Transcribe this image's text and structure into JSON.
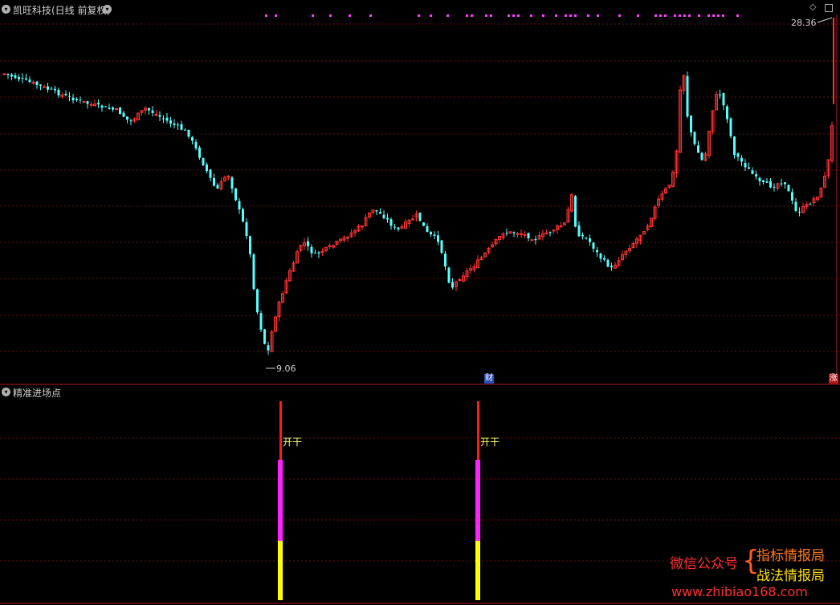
{
  "header": {
    "stock_title": "凯旺科技(日线 前复权)",
    "dropdown_icon": "chevron-down-icon",
    "corner_icons": [
      "diamond-icon",
      "panel-toggle-icon"
    ]
  },
  "main_chart": {
    "high_price_label": "28.36",
    "low_price_label": "9.06",
    "finance_badge": "财",
    "limit_badge": "涨"
  },
  "indicator": {
    "title": "精准进场点",
    "signal_label": "开干",
    "signals": [
      {
        "label": "开干"
      },
      {
        "label": "开干"
      }
    ]
  },
  "watermark": {
    "left": "微信公众号",
    "top_right": "指标情报局",
    "bottom_right": "战法情报局",
    "url": "www.zhibiao168.com"
  },
  "colors": {
    "up": "#ff3232",
    "down": "#54ffff",
    "grid": "#6b1010",
    "divider": "#b01818",
    "signal_top": "#ff1a1a",
    "signal_mid": "#ff22ff",
    "signal_bottom": "#ffff00",
    "marker_dots": "#ff3cff",
    "label_yellow": "#ffff66"
  }
}
